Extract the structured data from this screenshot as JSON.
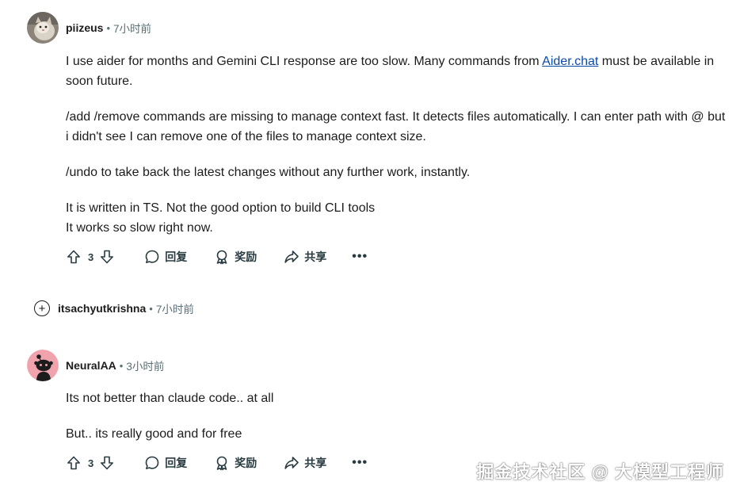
{
  "comments": [
    {
      "author": "piizeus",
      "time": "7小时前",
      "paragraphs": [
        {
          "before_link": "I use aider for months and Gemini CLI response are too slow. Many commands from ",
          "link": "Aider.chat",
          "after_link": " must be available in soon future."
        },
        "/add /remove commands are missing to manage context fast. It detects files automatically. I can enter path with @ but i didn't see I can remove one of the files to manage context size.",
        "/undo to take back the latest changes without any further work, instantly.",
        "It is written in TS. Not the good option to build CLI tools",
        "It works so slow right now."
      ],
      "votes": "3"
    },
    {
      "author": "itsachyutkrishna",
      "time": "7小时前",
      "collapsed": true
    },
    {
      "author": "NeuralAA",
      "time": "3小时前",
      "paragraphs": [
        "Its not better than claude code.. at all",
        "But.. its really good and for free"
      ],
      "votes": "3"
    }
  ],
  "actions": {
    "reply": "回复",
    "award": "奖励",
    "share": "共享",
    "more": "•••"
  },
  "separator": "•",
  "expand_symbol": "+",
  "watermark": "掘金技术社区 @ 大模型工程师",
  "colors": {
    "text": "#1c1c1c",
    "meta": "#576f76",
    "link": "#0a4aa8",
    "snoo_bg": "#f0a3ad"
  }
}
